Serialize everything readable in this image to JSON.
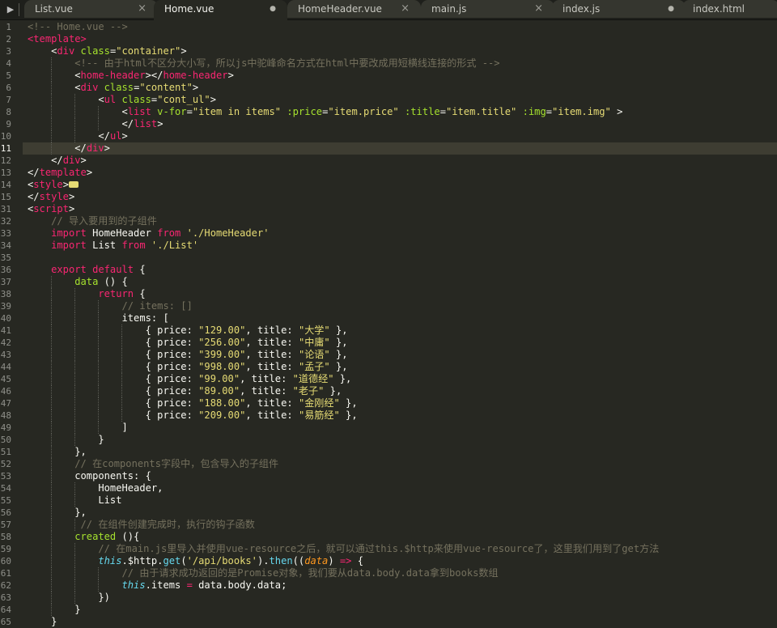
{
  "tabs": [
    {
      "label": "List.vue",
      "active": false,
      "marker": "close"
    },
    {
      "label": "Home.vue",
      "active": true,
      "marker": "dot"
    },
    {
      "label": "HomeHeader.vue",
      "active": false,
      "marker": "close"
    },
    {
      "label": "main.js",
      "active": false,
      "marker": "close"
    },
    {
      "label": "index.js",
      "active": false,
      "marker": "dot"
    },
    {
      "label": "index.html",
      "active": false,
      "marker": "none"
    }
  ],
  "tab_close_glyph": "×",
  "tab_dot_glyph": "●",
  "tabbar_arrow_icon": "play-arrow-icon",
  "current_line": "11",
  "line_numbers": [
    "1",
    "2",
    "3",
    "4",
    "5",
    "6",
    "7",
    "8",
    "9",
    "10",
    "11",
    "12",
    "13",
    "14",
    "15",
    "31",
    "32",
    "33",
    "34",
    "35",
    "36",
    "37",
    "38",
    "39",
    "40",
    "41",
    "42",
    "43",
    "44",
    "45",
    "46",
    "47",
    "48",
    "49",
    "50",
    "51",
    "52",
    "53",
    "54",
    "55",
    "56",
    "57",
    "58",
    "59",
    "60",
    "61",
    "62",
    "63",
    "64",
    "65"
  ],
  "code": [
    [
      [
        "cmt",
        "<!-- Home.vue -->"
      ]
    ],
    [
      [
        "tag",
        "<template>"
      ]
    ],
    [
      [
        "",
        "    <"
      ],
      [
        "tag",
        "div"
      ],
      [
        "att",
        " class"
      ],
      [
        "",
        "="
      ],
      [
        "str",
        "\"container\""
      ],
      [
        "",
        ">"
      ]
    ],
    [
      [
        "",
        "        "
      ],
      [
        "cmt",
        "<!-- 由于html不区分大小写，所以js中驼峰命名方式在html中要改成用短横线连接的形式 -->"
      ]
    ],
    [
      [
        "",
        "        <"
      ],
      [
        "tag",
        "home-header"
      ],
      [
        "",
        "></"
      ],
      [
        "tag",
        "home-header"
      ],
      [
        "",
        ">"
      ]
    ],
    [
      [
        "",
        "        <"
      ],
      [
        "tag",
        "div"
      ],
      [
        "att",
        " class"
      ],
      [
        "",
        "="
      ],
      [
        "str",
        "\"content\""
      ],
      [
        "",
        ">"
      ]
    ],
    [
      [
        "",
        "            <"
      ],
      [
        "tag",
        "ul"
      ],
      [
        "att",
        " class"
      ],
      [
        "",
        "="
      ],
      [
        "str",
        "\"cont_ul\""
      ],
      [
        "",
        ">"
      ]
    ],
    [
      [
        "",
        "                <"
      ],
      [
        "tag",
        "list"
      ],
      [
        "att",
        " v-for"
      ],
      [
        "",
        "="
      ],
      [
        "str",
        "\"item in items\""
      ],
      [
        "att",
        " :price"
      ],
      [
        "",
        "="
      ],
      [
        "str",
        "\"item.price\""
      ],
      [
        "att",
        " :title"
      ],
      [
        "",
        "="
      ],
      [
        "str",
        "\"item.title\""
      ],
      [
        "att",
        " :img"
      ],
      [
        "",
        "="
      ],
      [
        "str",
        "\"item.img\""
      ],
      [
        "",
        " >"
      ]
    ],
    [
      [
        "",
        "                </"
      ],
      [
        "tag",
        "list"
      ],
      [
        "",
        ">"
      ]
    ],
    [
      [
        "",
        "            </"
      ],
      [
        "tag",
        "ul"
      ],
      [
        "",
        ">"
      ]
    ],
    [
      [
        "",
        "        </"
      ],
      [
        "tag",
        "div"
      ],
      [
        "",
        ">"
      ]
    ],
    [
      [
        "",
        "    </"
      ],
      [
        "tag",
        "div"
      ],
      [
        "",
        ">"
      ]
    ],
    [
      [
        "",
        "</"
      ],
      [
        "tag",
        "template"
      ],
      [
        "",
        ">"
      ]
    ],
    [
      [
        "",
        "<"
      ],
      [
        "tag",
        "style"
      ],
      [
        "",
        ">"
      ],
      [
        "fold",
        ""
      ]
    ],
    [
      [
        "",
        "</"
      ],
      [
        "tag",
        "style"
      ],
      [
        "",
        ">"
      ]
    ],
    [
      [
        "",
        "<"
      ],
      [
        "tag",
        "script"
      ],
      [
        "",
        ">"
      ]
    ],
    [
      [
        "",
        "    "
      ],
      [
        "cmt",
        "// 导入要用到的子组件"
      ]
    ],
    [
      [
        "",
        "    "
      ],
      [
        "kw",
        "import"
      ],
      [
        "",
        " HomeHeader "
      ],
      [
        "kw",
        "from"
      ],
      [
        "",
        " "
      ],
      [
        "str",
        "'./HomeHeader'"
      ]
    ],
    [
      [
        "",
        "    "
      ],
      [
        "kw",
        "import"
      ],
      [
        "",
        " List "
      ],
      [
        "kw",
        "from"
      ],
      [
        "",
        " "
      ],
      [
        "str",
        "'./List'"
      ]
    ],
    [
      [
        "",
        ""
      ]
    ],
    [
      [
        "",
        "    "
      ],
      [
        "kw",
        "export"
      ],
      [
        "",
        " "
      ],
      [
        "kw",
        "default"
      ],
      [
        "",
        " {"
      ]
    ],
    [
      [
        "",
        "        "
      ],
      [
        "att",
        "data"
      ],
      [
        "",
        " () {"
      ]
    ],
    [
      [
        "",
        "            "
      ],
      [
        "kw",
        "return"
      ],
      [
        "",
        " {"
      ]
    ],
    [
      [
        "",
        "                "
      ],
      [
        "cmt",
        "// items: []"
      ]
    ],
    [
      [
        "",
        "                items: ["
      ]
    ],
    [
      [
        "",
        "                    { price: "
      ],
      [
        "str",
        "\"129.00\""
      ],
      [
        "",
        ", title: "
      ],
      [
        "str",
        "\"大学\""
      ],
      [
        "",
        " },"
      ]
    ],
    [
      [
        "",
        "                    { price: "
      ],
      [
        "str",
        "\"256.00\""
      ],
      [
        "",
        ", title: "
      ],
      [
        "str",
        "\"中庸\""
      ],
      [
        "",
        " },"
      ]
    ],
    [
      [
        "",
        "                    { price: "
      ],
      [
        "str",
        "\"399.00\""
      ],
      [
        "",
        ", title: "
      ],
      [
        "str",
        "\"论语\""
      ],
      [
        "",
        " },"
      ]
    ],
    [
      [
        "",
        "                    { price: "
      ],
      [
        "str",
        "\"998.00\""
      ],
      [
        "",
        ", title: "
      ],
      [
        "str",
        "\"孟子\""
      ],
      [
        "",
        " },"
      ]
    ],
    [
      [
        "",
        "                    { price: "
      ],
      [
        "str",
        "\"99.00\""
      ],
      [
        "",
        ", title: "
      ],
      [
        "str",
        "\"道德经\""
      ],
      [
        "",
        " },"
      ]
    ],
    [
      [
        "",
        "                    { price: "
      ],
      [
        "str",
        "\"89.00\""
      ],
      [
        "",
        ", title: "
      ],
      [
        "str",
        "\"老子\""
      ],
      [
        "",
        " },"
      ]
    ],
    [
      [
        "",
        "                    { price: "
      ],
      [
        "str",
        "\"188.00\""
      ],
      [
        "",
        ", title: "
      ],
      [
        "str",
        "\"金刚经\""
      ],
      [
        "",
        " },"
      ]
    ],
    [
      [
        "",
        "                    { price: "
      ],
      [
        "str",
        "\"209.00\""
      ],
      [
        "",
        ", title: "
      ],
      [
        "str",
        "\"易筋经\""
      ],
      [
        "",
        " },"
      ]
    ],
    [
      [
        "",
        "                ]"
      ]
    ],
    [
      [
        "",
        "            }"
      ]
    ],
    [
      [
        "",
        "        },"
      ]
    ],
    [
      [
        "",
        "        "
      ],
      [
        "cmt",
        "// 在components字段中，包含导入的子组件"
      ]
    ],
    [
      [
        "",
        "        components: {"
      ]
    ],
    [
      [
        "",
        "            HomeHeader,"
      ]
    ],
    [
      [
        "",
        "            List"
      ]
    ],
    [
      [
        "",
        "        },"
      ]
    ],
    [
      [
        "",
        "         "
      ],
      [
        "cmt",
        "// 在组件创建完成时，执行的钩子函数"
      ]
    ],
    [
      [
        "",
        "        "
      ],
      [
        "att",
        "created"
      ],
      [
        "",
        " (){"
      ]
    ],
    [
      [
        "",
        "            "
      ],
      [
        "cmt",
        "// 在main.js里导入并使用vue-resource之后，就可以通过this.$http来使用vue-resource了，这里我们用到了get方法"
      ]
    ],
    [
      [
        "",
        "            "
      ],
      [
        "sf",
        "this"
      ],
      [
        "",
        ".$http."
      ],
      [
        "fn",
        "get"
      ],
      [
        "",
        "("
      ],
      [
        "str",
        "'/api/books'"
      ],
      [
        "",
        ")."
      ],
      [
        "fn",
        "then"
      ],
      [
        "",
        "(("
      ],
      [
        "it",
        "data"
      ],
      [
        "",
        ") "
      ],
      [
        "kw",
        "=>"
      ],
      [
        "",
        " {"
      ]
    ],
    [
      [
        "",
        "                "
      ],
      [
        "cmt",
        "// 由于请求成功返回的是Promise对象，我们要从data.body.data拿到books数组"
      ]
    ],
    [
      [
        "",
        "                "
      ],
      [
        "sf",
        "this"
      ],
      [
        "",
        ".items "
      ],
      [
        "kw",
        "="
      ],
      [
        "",
        " data.body.data;"
      ]
    ],
    [
      [
        "",
        "            })"
      ]
    ],
    [
      [
        "",
        "        }"
      ]
    ],
    [
      [
        "",
        "    }"
      ]
    ]
  ]
}
